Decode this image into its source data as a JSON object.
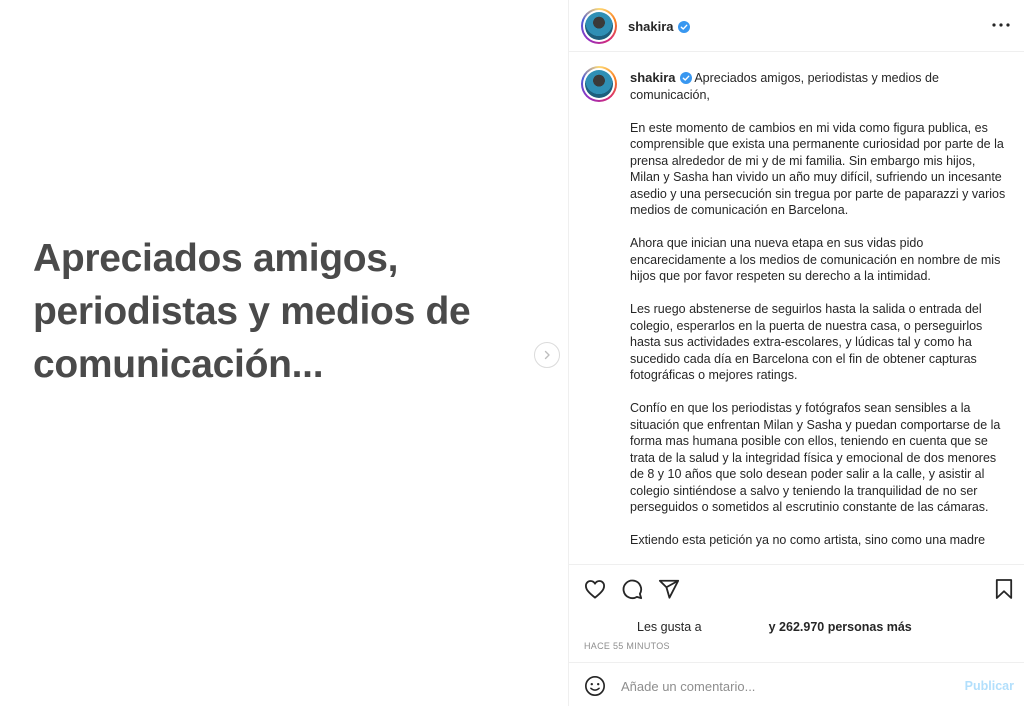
{
  "media": {
    "slide_text_lines": [
      "Apreciados amigos,",
      "periodistas y  medios de",
      "comunicación..."
    ]
  },
  "header": {
    "username": "shakira"
  },
  "caption": {
    "username": "shakira",
    "intro": "Apreciados amigos, periodistas y medios de comunicación,",
    "paragraphs": [
      "En este momento de cambios en mi vida como figura publica, es comprensible que exista una permanente curiosidad por parte de la prensa alrededor de mi y de mi familia. Sin embargo mis hijos, Milan y Sasha han vivido un año muy difícil, sufriendo un incesante asedio y una persecución sin tregua por parte de paparazzi y varios medios de comunicación en Barcelona.",
      "Ahora que inician una nueva etapa en sus vidas pido encarecidamente a los medios de comunicación en nombre de mis hijos que por favor respeten su derecho a la intimidad.",
      "Les ruego abstenerse de seguirlos hasta la salida o entrada del colegio, esperarlos en la puerta de nuestra casa, o perseguirlos hasta sus actividades extra-escolares, y lúdicas tal y como ha sucedido cada día en Barcelona con el fin de obtener capturas fotográficas o mejores ratings.",
      "Confío en que los periodistas y fotógrafos sean sensibles a la situación que enfrentan Milan y Sasha y puedan comportarse de la forma mas humana posible con ellos, teniendo en cuenta que se trata de la salud y la integridad física y emocional de dos menores de 8 y 10 años que solo desean poder salir a la calle, y asistir al colegio sintiéndose a salvo y teniendo la tranquilidad de no ser perseguidos o sometidos al escrutinio constante de las cámaras.",
      "Extiendo esta petición ya no como artista, sino como una madre"
    ]
  },
  "likes": {
    "prefix": "Les gusta a",
    "suffix": "y 262.970 personas más"
  },
  "timestamp": "HACE 55 MINUTOS",
  "comment": {
    "placeholder": "Añade un comentario...",
    "publish_label": "Publicar"
  },
  "icons": {
    "next": "chevron-right-icon",
    "more": "more-options-icon",
    "like": "heart-icon",
    "comment": "comment-icon",
    "share": "share-icon",
    "save": "bookmark-icon",
    "emoji": "emoji-icon",
    "verified": "verified-badge-icon"
  },
  "colors": {
    "verified": "#3897f0",
    "publish_disabled": "#b2dffc",
    "muted": "#8e8e8e",
    "slide_text": "#4a4a4a"
  }
}
